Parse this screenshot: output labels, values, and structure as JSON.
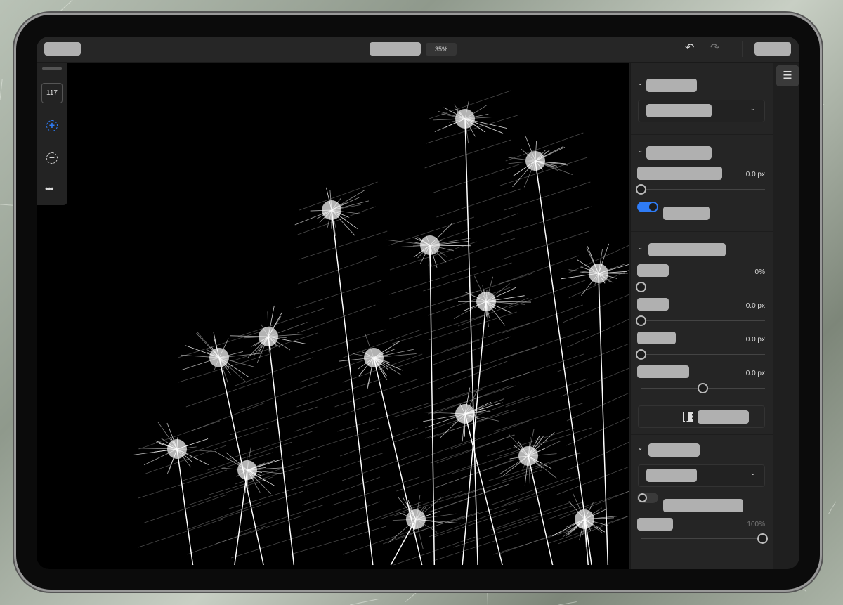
{
  "toolbar": {
    "zoom_level": "35%",
    "undo_icon": "undo-icon",
    "redo_icon": "redo-icon"
  },
  "left_tools": {
    "brush_size": "117",
    "items": [
      "zoom-in-icon",
      "zoom-out-icon",
      "more-icon"
    ]
  },
  "panel": {
    "section2": {
      "value": "0.0 px",
      "slider_fraction": 0,
      "toggle_on": true
    },
    "section3": {
      "rows": [
        {
          "value": "0%",
          "slider_fraction": 0
        },
        {
          "value": "0.0 px",
          "slider_fraction": 0
        },
        {
          "value": "0.0 px",
          "slider_fraction": 0
        },
        {
          "value": "0.0 px",
          "slider_fraction": 0.5
        }
      ]
    },
    "section4": {
      "toggle_on": false,
      "value": "100%",
      "slider_fraction": 1
    }
  },
  "colors": {
    "accent": "#2f7cf6"
  }
}
